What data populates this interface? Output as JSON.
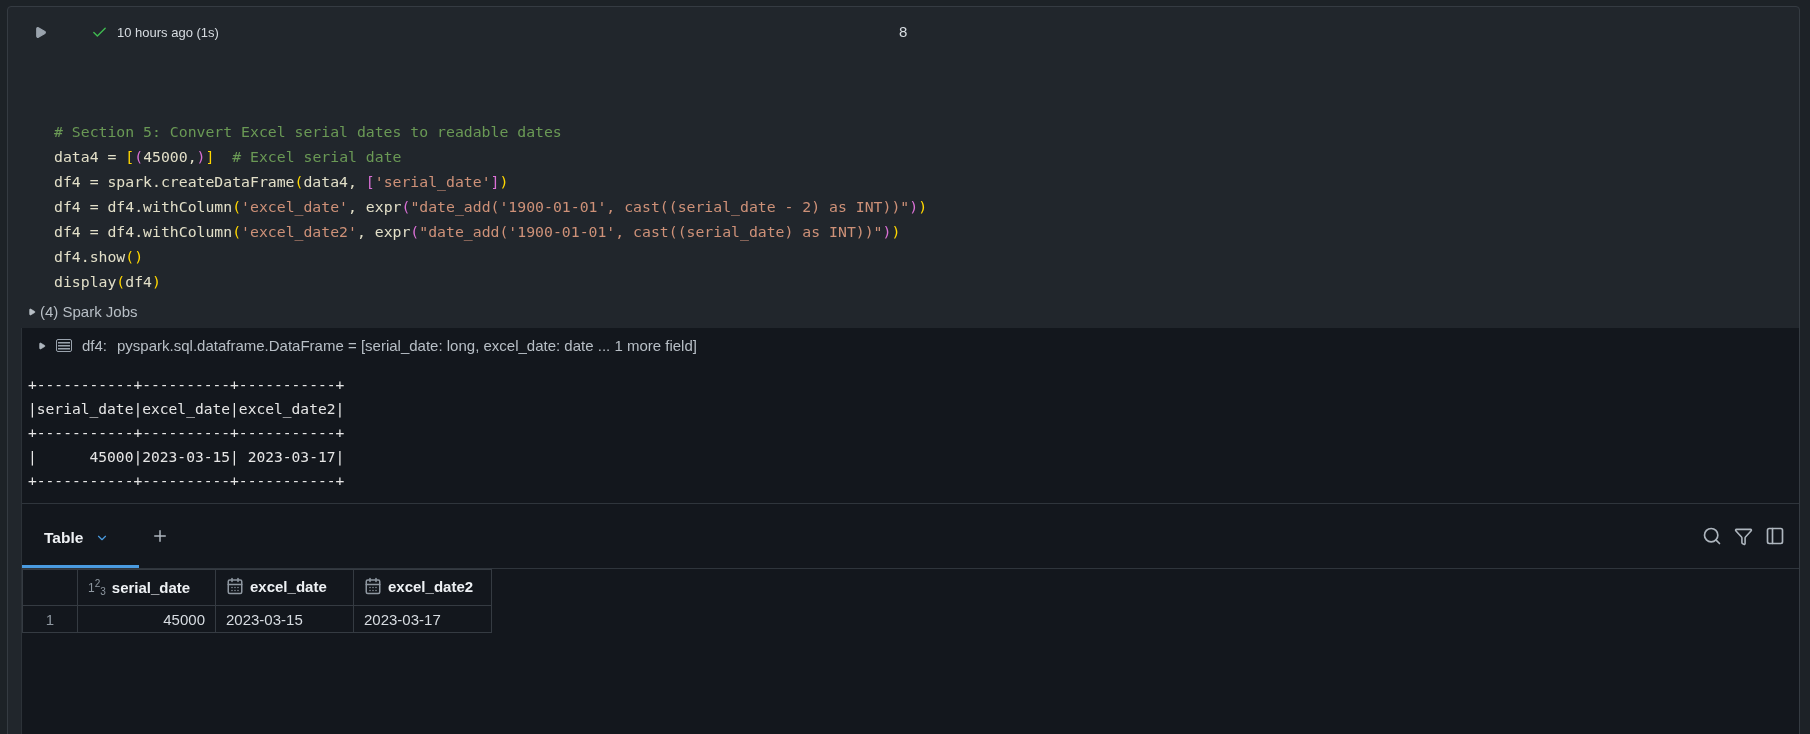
{
  "cell": {
    "succeeded": true,
    "run_time": "10 hours ago (1s)",
    "cell_number": "8",
    "code_lines": [
      [
        {
          "kind": "comment",
          "text": "# Section 5: Convert Excel serial dates to readable dates"
        }
      ],
      [
        {
          "kind": "plain",
          "text": "data4 = "
        },
        {
          "kind": "outer",
          "text": "["
        },
        {
          "kind": "inner",
          "text": "("
        },
        {
          "kind": "plain",
          "text": "45000,"
        },
        {
          "kind": "inner",
          "text": ")"
        },
        {
          "kind": "outer",
          "text": "]"
        },
        {
          "kind": "comment",
          "text": "  # Excel serial date"
        }
      ],
      [
        {
          "kind": "plain",
          "text": "df4 = spark.createDataFrame"
        },
        {
          "kind": "outer",
          "text": "("
        },
        {
          "kind": "plain",
          "text": "data4, "
        },
        {
          "kind": "inner",
          "text": "["
        },
        {
          "kind": "string",
          "text": "'serial_date'"
        },
        {
          "kind": "inner",
          "text": "]"
        },
        {
          "kind": "outer",
          "text": ")"
        }
      ],
      [
        {
          "kind": "plain",
          "text": "df4 = df4.withColumn"
        },
        {
          "kind": "outer",
          "text": "("
        },
        {
          "kind": "string",
          "text": "'excel_date'"
        },
        {
          "kind": "plain",
          "text": ", expr"
        },
        {
          "kind": "inner",
          "text": "("
        },
        {
          "kind": "string",
          "text": "\"date_add('1900-01-01', cast((serial_date - 2) as INT))\""
        },
        {
          "kind": "inner",
          "text": ")"
        },
        {
          "kind": "outer",
          "text": ")"
        }
      ],
      [
        {
          "kind": "plain",
          "text": "df4 = df4.withColumn"
        },
        {
          "kind": "outer",
          "text": "("
        },
        {
          "kind": "string",
          "text": "'excel_date2'"
        },
        {
          "kind": "plain",
          "text": ", expr"
        },
        {
          "kind": "inner",
          "text": "("
        },
        {
          "kind": "string",
          "text": "\"date_add('1900-01-01', cast((serial_date) as INT))\""
        },
        {
          "kind": "inner",
          "text": ")"
        },
        {
          "kind": "outer",
          "text": ")"
        }
      ],
      [
        {
          "kind": "plain",
          "text": "df4.show"
        },
        {
          "kind": "outer",
          "text": "()"
        }
      ],
      [
        {
          "kind": "plain",
          "text": "display"
        },
        {
          "kind": "outer",
          "text": "("
        },
        {
          "kind": "plain",
          "text": "df4"
        },
        {
          "kind": "outer",
          "text": ")"
        }
      ]
    ],
    "spark_jobs": {
      "label": "(4) Spark Jobs",
      "expanded": false
    }
  },
  "output": {
    "schema": {
      "name": "df4:",
      "type": "pyspark.sql.dataframe.DataFrame = [serial_date: long, excel_date: date ... 1 more field]",
      "expanded": false
    },
    "text_lines": [
      "+-----------+----------+-----------+",
      "|serial_date|excel_date|excel_date2|",
      "+-----------+----------+-----------+",
      "|      45000|2023-03-15| 2023-03-17|",
      "+-----------+----------+-----------+"
    ],
    "tabs": [
      {
        "label": "Table",
        "selected": true
      }
    ],
    "table": {
      "columns": [
        {
          "name": "serial_date",
          "kind": "number",
          "type_glyph": "1$^{2}$$_{3}$"
        },
        {
          "name": "excel_date",
          "kind": "date"
        },
        {
          "name": "excel_date2",
          "kind": "date"
        }
      ],
      "rows": [
        {
          "index": "1",
          "cells": [
            "45000",
            "2023-03-15",
            "2023-03-17"
          ]
        }
      ]
    }
  }
}
